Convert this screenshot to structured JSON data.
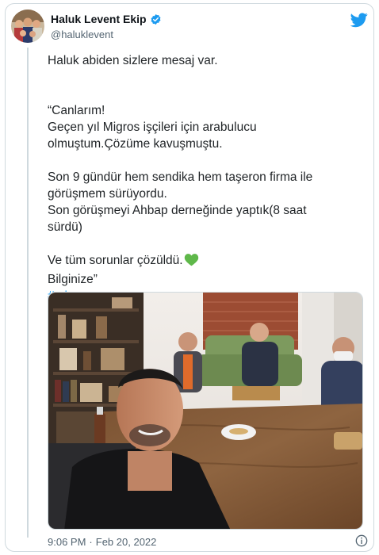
{
  "tweet": {
    "author": {
      "display_name": "Haluk Levent Ekip",
      "handle": "@haluklevent",
      "verified": true
    },
    "brand_icon": "twitter-bird-icon",
    "lines": {
      "intro": "Haluk abiden sizlere mesaj var.",
      "quote_open": "“Canlarım!",
      "p1_l1": "Geçen yıl Migros işçileri için arabulucu",
      "p1_l2": "olmuştum.Çözüme kavuşmuştu.",
      "p2_l1": "Son 9 gündür hem sendika hem taşeron firma ile",
      "p2_l2": "görüşmem sürüyordu.",
      "p2_l3": "Son görüşmeyi Ahbap derneğinde yaptık(8 saat",
      "p2_l4": "sürdü)",
      "p3_l1": "Ve tüm sorunlar çözüldü.",
      "p3_emoji": "💚",
      "p3_l2": "Bilginize”",
      "hashtag": "#migros"
    },
    "time": "9:06 PM",
    "separator": "·",
    "date": "Feb 20, 2022",
    "info_icon": "info-icon"
  },
  "colors": {
    "link_blue": "#1d9bf0",
    "verified_blue": "#1d9bf0",
    "text": "#0f1419",
    "secondary_text": "#536471",
    "border": "#cfd9de",
    "heart_green": "#5fb84a"
  }
}
